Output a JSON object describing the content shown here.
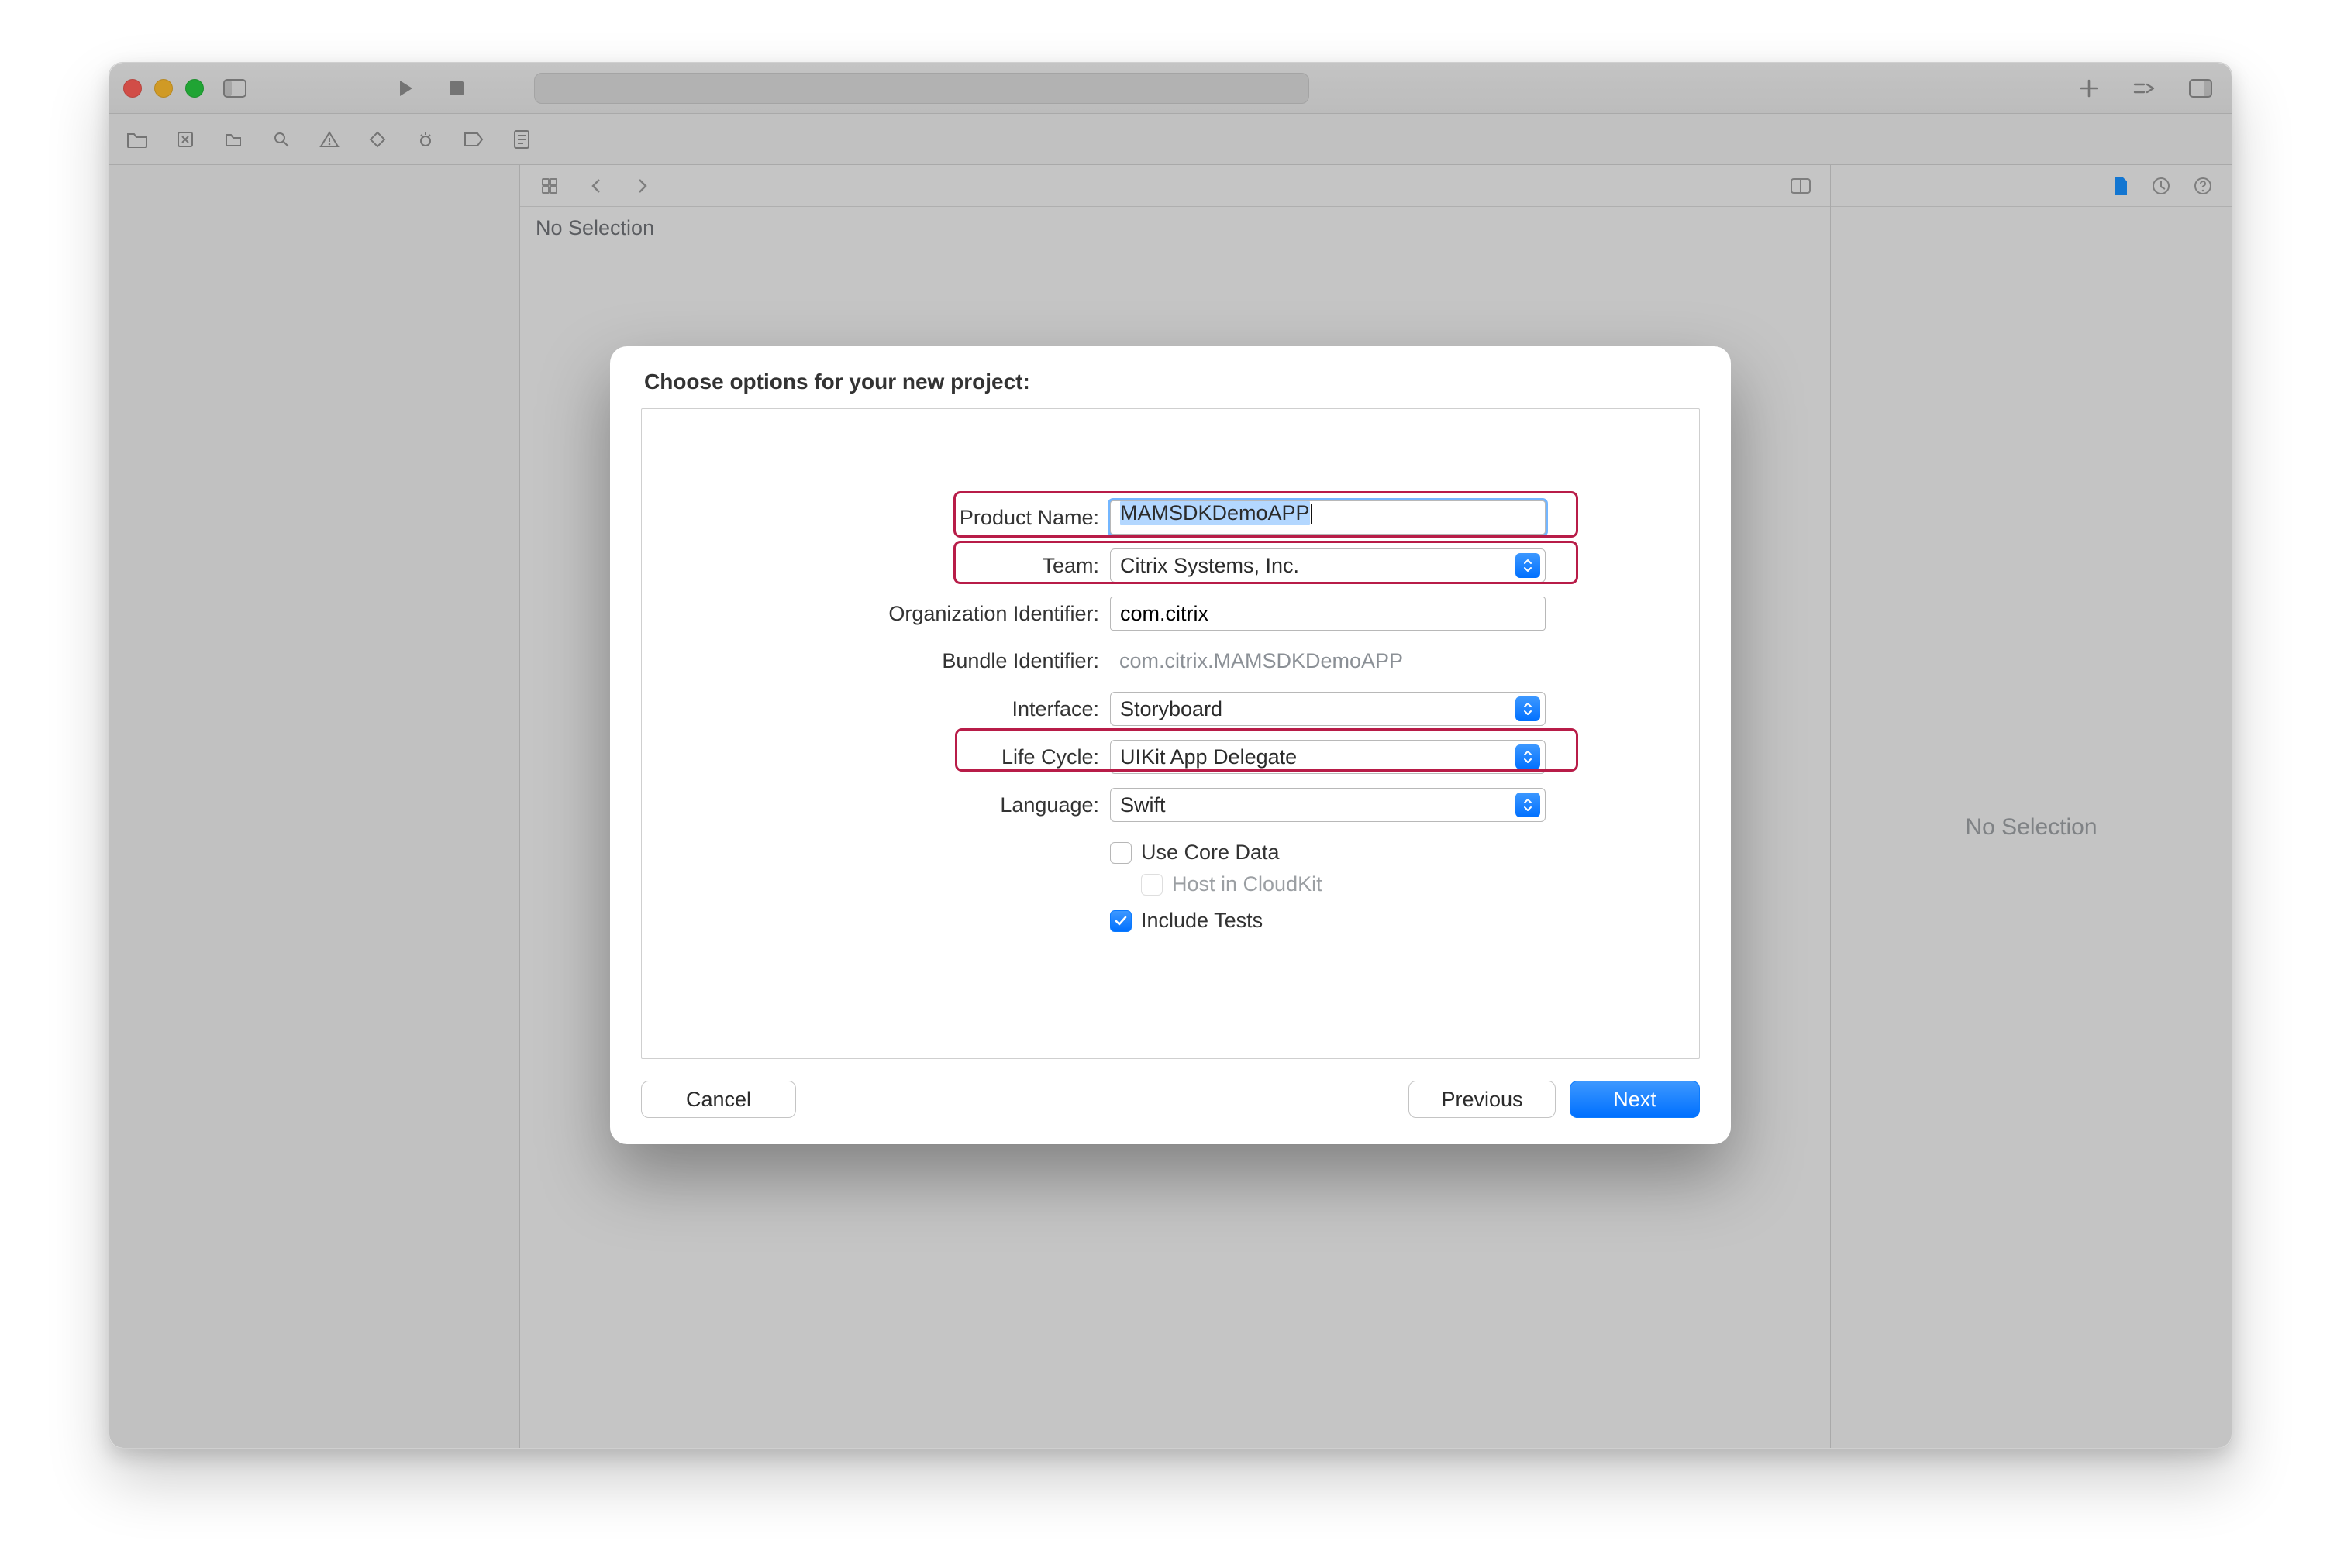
{
  "navigator": {
    "no_selection": "No Selection"
  },
  "inspector": {
    "no_selection": "No Selection"
  },
  "sheet": {
    "title": "Choose options for your new project:",
    "fields": {
      "product_name_label": "Product Name:",
      "product_name_value": "MAMSDKDemoAPP",
      "team_label": "Team:",
      "team_value": "Citrix Systems, Inc.",
      "org_id_label": "Organization Identifier:",
      "org_id_value": "com.citrix",
      "bundle_id_label": "Bundle Identifier:",
      "bundle_id_value": "com.citrix.MAMSDKDemoAPP",
      "interface_label": "Interface:",
      "interface_value": "Storyboard",
      "lifecycle_label": "Life Cycle:",
      "lifecycle_value": "UIKit App Delegate",
      "language_label": "Language:",
      "language_value": "Swift",
      "use_core_data_label": "Use Core Data",
      "use_core_data_checked": false,
      "host_cloudkit_label": "Host in CloudKit",
      "host_cloudkit_enabled": false,
      "include_tests_label": "Include Tests",
      "include_tests_checked": true
    },
    "buttons": {
      "cancel": "Cancel",
      "previous": "Previous",
      "next": "Next"
    }
  }
}
